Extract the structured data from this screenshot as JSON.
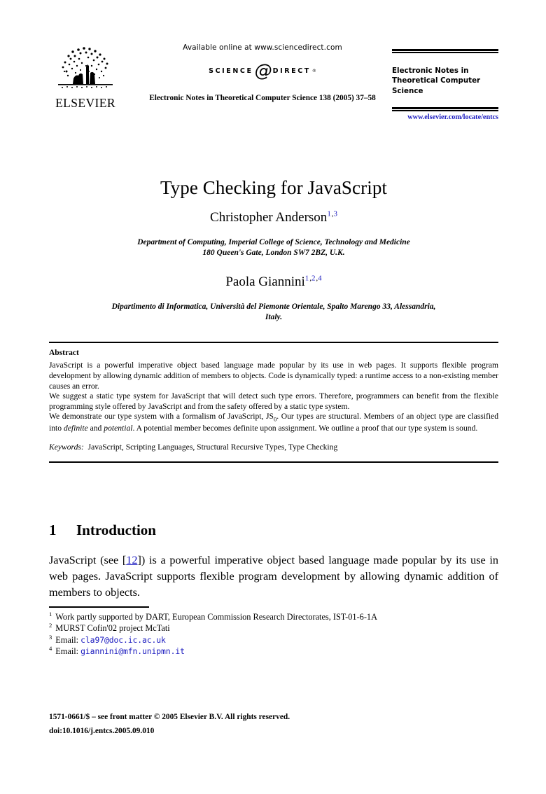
{
  "masthead": {
    "publisher_name": "ELSEVIER",
    "publisher_logo_icon": "elsevier-tree-icon",
    "available_online": "Available online at www.sciencedirect.com",
    "sciencedirect": {
      "word_science": "SCIENCE",
      "at_glyph": "@",
      "word_direct": "DIRECT",
      "registered_mark": "®"
    },
    "running_head": "Electronic Notes in Theoretical Computer Science 138 (2005) 37–58",
    "journal_title": "Electronic Notes in Theoretical Computer Science",
    "journal_url": "www.elsevier.com/locate/entcs"
  },
  "article": {
    "title": "Type Checking for JavaScript",
    "authors": [
      {
        "name": "Christopher Anderson",
        "superscripts": [
          "1",
          "3"
        ],
        "affiliation": "Department of Computing, Imperial College of Science, Technology and Medicine\n180 Queen's Gate, London SW7 2BZ, U.K."
      },
      {
        "name": "Paola Giannini",
        "superscripts": [
          "1",
          "2",
          "4"
        ],
        "affiliation": "Dipartimento di Informatica, Università del Piemonte Orientale, Spalto Marengo 33, Alessandria,\nItaly."
      }
    ]
  },
  "abstract": {
    "heading": "Abstract",
    "paragraphs": [
      "JavaScript is a powerful imperative object based language made popular by its use in web pages. It supports flexible program development by allowing dynamic addition of members to objects. Code is dynamically typed: a runtime access to a non-existing member causes an error.",
      "We suggest a static type system for JavaScript that will detect such type errors. Therefore, programmers can benefit from the flexible programming style offered by JavaScript and from the safety offered by a static type system.",
      "We demonstrate our type system with a formalism of JavaScript, JS0. Our types are structural. Members of an object type are classified into definite and potential. A potential member becomes definite upon assignment. We outline a proof that our type system is sound."
    ],
    "keywords_label": "Keywords:",
    "keywords": "JavaScript, Scripting Languages, Structural Recursive Types, Type Checking"
  },
  "section": {
    "number": "1",
    "heading": "Introduction",
    "paragraph_pre": "JavaScript (see [",
    "citation": "12",
    "paragraph_post": "]) is a powerful imperative object based language made popular by its use in web pages. JavaScript supports flexible program development by allowing dynamic addition of members to objects."
  },
  "footnotes": [
    {
      "marker": "1",
      "text": "Work partly supported by DART, European Commission Research Directorates, IST-01-6-1A",
      "email": ""
    },
    {
      "marker": "2",
      "text": "MURST Cofin'02 project McTati",
      "email": ""
    },
    {
      "marker": "3",
      "text": "Email:",
      "email": "cla97@doc.ic.ac.uk"
    },
    {
      "marker": "4",
      "text": "Email:",
      "email": "giannini@mfn.unipmn.it"
    }
  ],
  "colophon": {
    "front_matter": "1571-0661/$ – see front matter © 2005 Elsevier B.V. All rights reserved.",
    "doi": "doi:10.1016/j.entcs.2005.09.010"
  },
  "colors": {
    "link_blue": "#1A1ABF",
    "text_black": "#000000",
    "page_background": "#FFFFFF"
  }
}
